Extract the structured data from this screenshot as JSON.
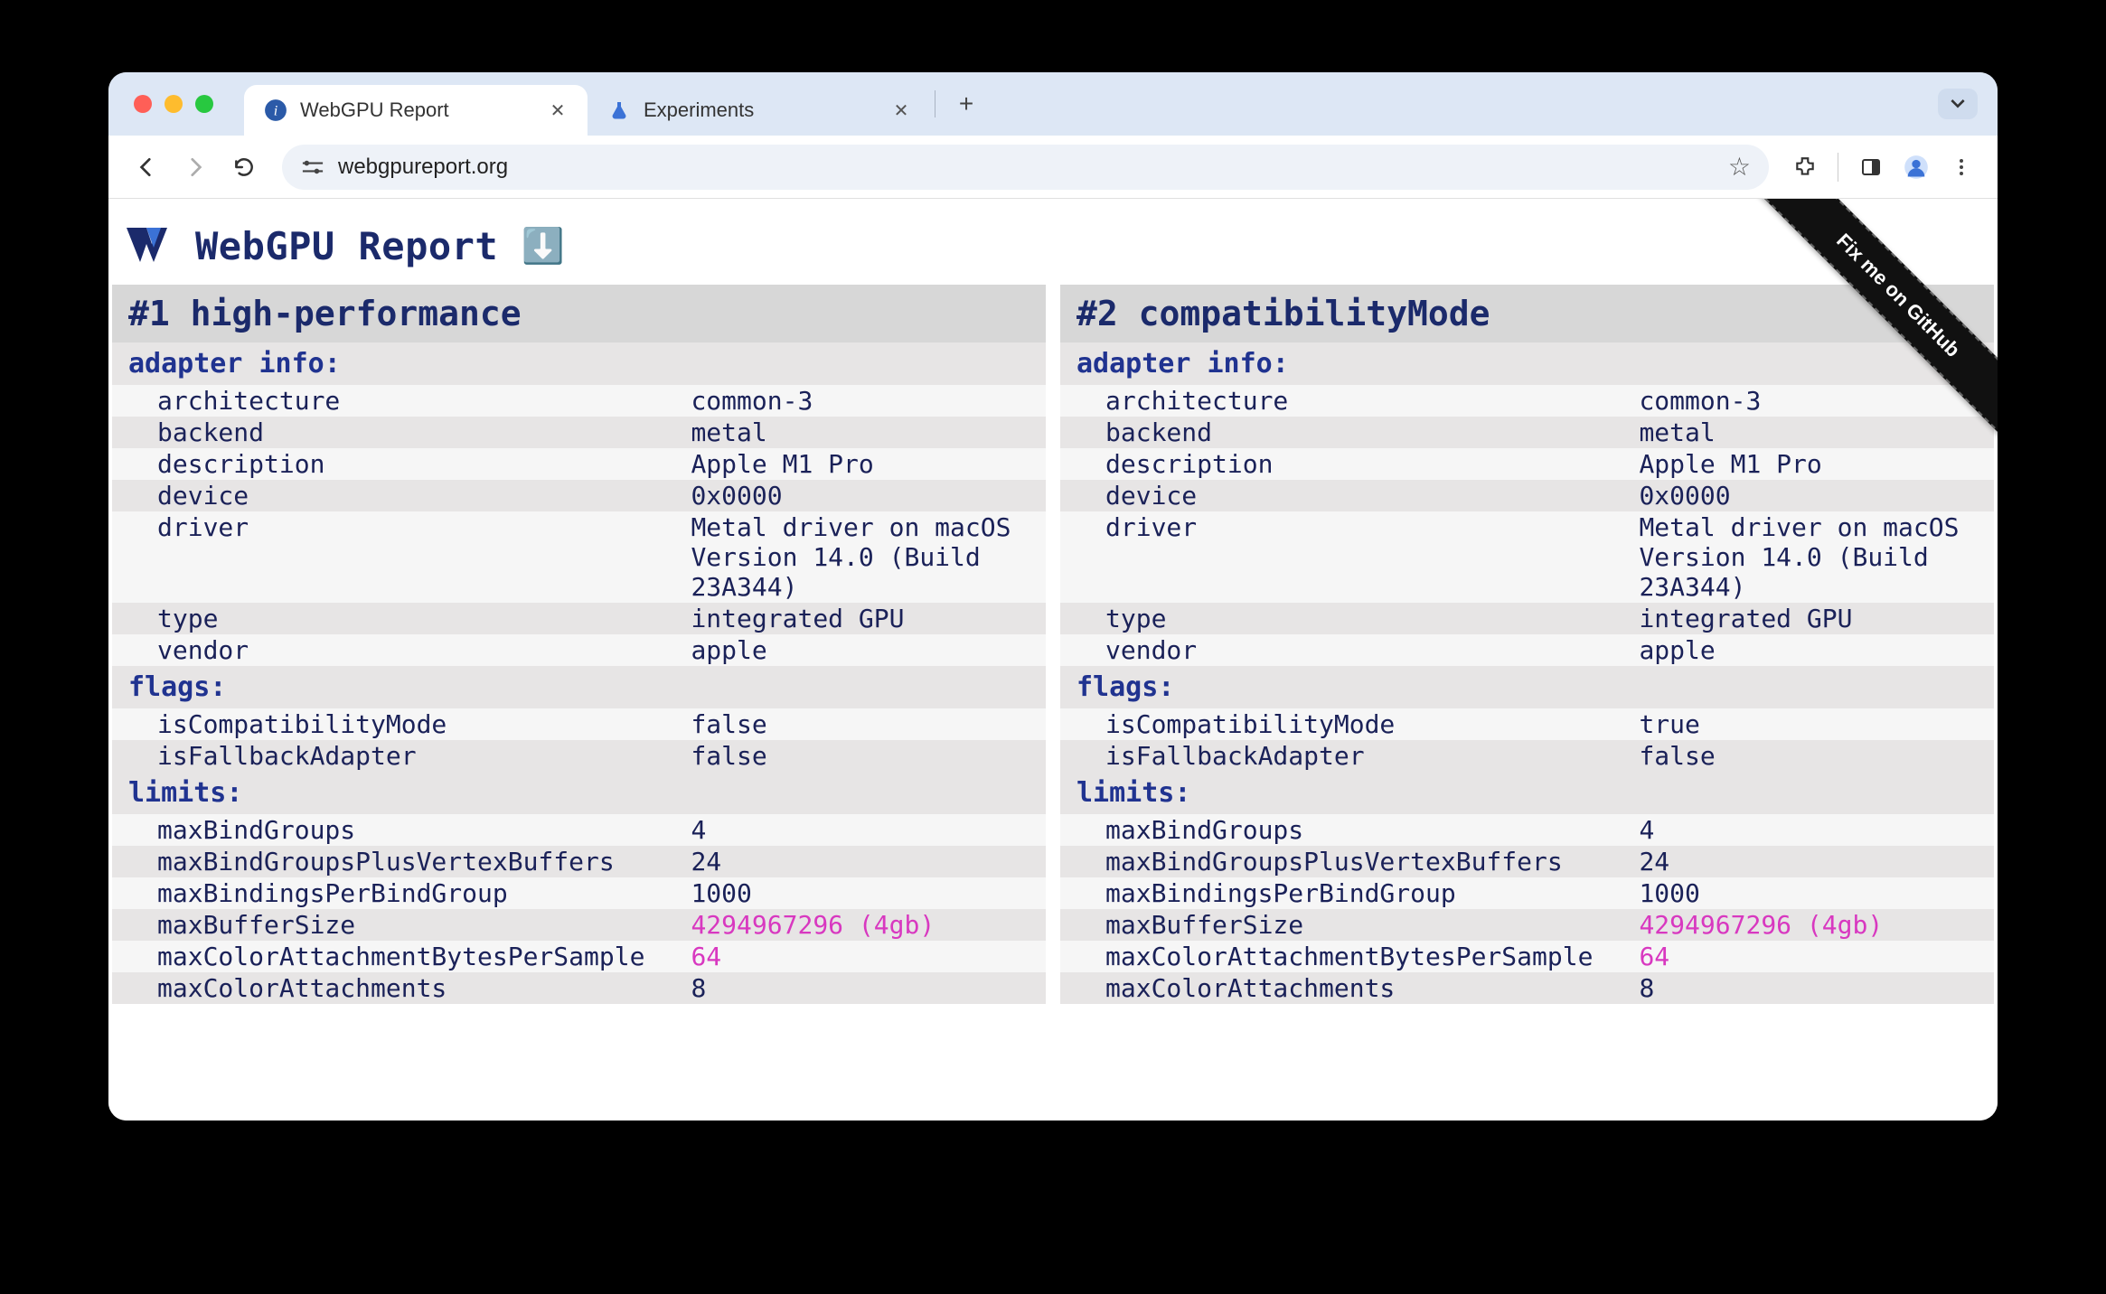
{
  "browser": {
    "tabs": [
      {
        "title": "WebGPU Report",
        "active": true,
        "favicon": "info"
      },
      {
        "title": "Experiments",
        "active": false,
        "favicon": "flask"
      }
    ],
    "url": "webgpureport.org"
  },
  "page": {
    "title": "WebGPU Report",
    "download_glyph": "⬇️",
    "github_ribbon": "Fix me on GitHub"
  },
  "adapters": [
    {
      "heading": "#1 high-performance",
      "sections": {
        "adapter_info": {
          "label": "adapter info:",
          "rows": [
            {
              "k": "architecture",
              "v": "common-3"
            },
            {
              "k": "backend",
              "v": "metal"
            },
            {
              "k": "description",
              "v": "Apple M1 Pro"
            },
            {
              "k": "device",
              "v": "0x0000"
            },
            {
              "k": "driver",
              "v": "Metal driver on macOS Version 14.0 (Build 23A344)"
            },
            {
              "k": "type",
              "v": "integrated GPU"
            },
            {
              "k": "vendor",
              "v": "apple"
            }
          ]
        },
        "flags": {
          "label": "flags:",
          "rows": [
            {
              "k": "isCompatibilityMode",
              "v": "false"
            },
            {
              "k": "isFallbackAdapter",
              "v": "false"
            }
          ]
        },
        "limits": {
          "label": "limits:",
          "rows": [
            {
              "k": "maxBindGroups",
              "v": "4"
            },
            {
              "k": "maxBindGroupsPlusVertexBuffers",
              "v": "24"
            },
            {
              "k": "maxBindingsPerBindGroup",
              "v": "1000"
            },
            {
              "k": "maxBufferSize",
              "v": "4294967296 (4gb)",
              "highlight": true
            },
            {
              "k": "maxColorAttachmentBytesPerSample",
              "v": "64",
              "highlight": true
            },
            {
              "k": "maxColorAttachments",
              "v": "8"
            }
          ]
        }
      }
    },
    {
      "heading": "#2 compatibilityMode",
      "sections": {
        "adapter_info": {
          "label": "adapter info:",
          "rows": [
            {
              "k": "architecture",
              "v": "common-3"
            },
            {
              "k": "backend",
              "v": "metal"
            },
            {
              "k": "description",
              "v": "Apple M1 Pro"
            },
            {
              "k": "device",
              "v": "0x0000"
            },
            {
              "k": "driver",
              "v": "Metal driver on macOS Version 14.0 (Build 23A344)"
            },
            {
              "k": "type",
              "v": "integrated GPU"
            },
            {
              "k": "vendor",
              "v": "apple"
            }
          ]
        },
        "flags": {
          "label": "flags:",
          "rows": [
            {
              "k": "isCompatibilityMode",
              "v": "true"
            },
            {
              "k": "isFallbackAdapter",
              "v": "false"
            }
          ]
        },
        "limits": {
          "label": "limits:",
          "rows": [
            {
              "k": "maxBindGroups",
              "v": "4"
            },
            {
              "k": "maxBindGroupsPlusVertexBuffers",
              "v": "24"
            },
            {
              "k": "maxBindingsPerBindGroup",
              "v": "1000"
            },
            {
              "k": "maxBufferSize",
              "v": "4294967296 (4gb)",
              "highlight": true
            },
            {
              "k": "maxColorAttachmentBytesPerSample",
              "v": "64",
              "highlight": true
            },
            {
              "k": "maxColorAttachments",
              "v": "8"
            }
          ]
        }
      }
    }
  ]
}
